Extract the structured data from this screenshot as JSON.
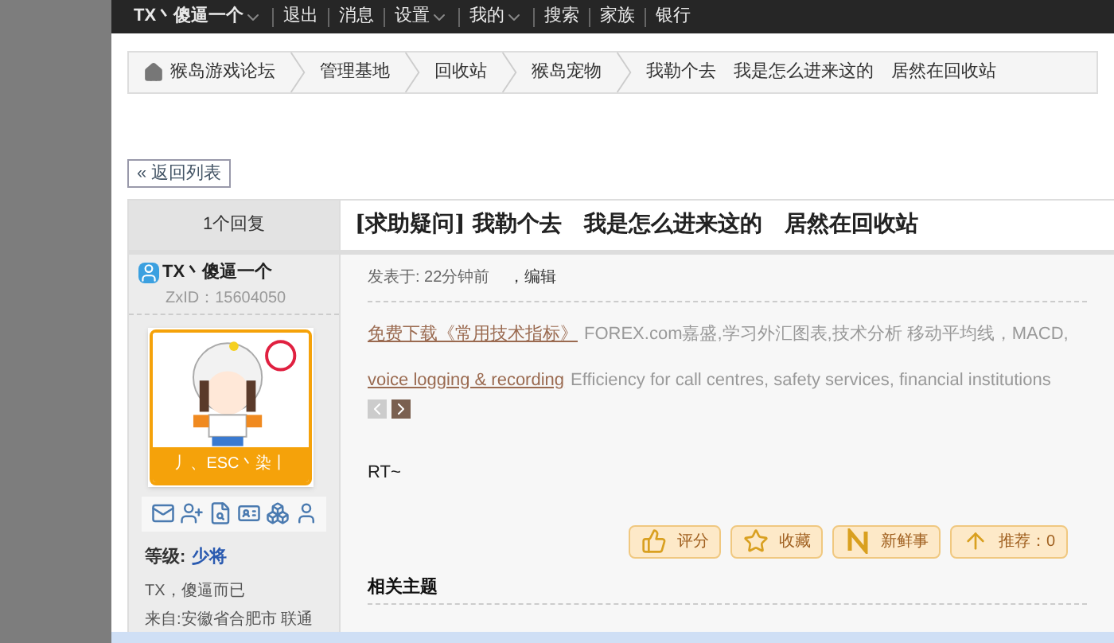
{
  "top_nav": [
    {
      "label": "TX丶傻逼一个",
      "dropdown": true
    },
    {
      "label": "退出",
      "dropdown": false
    },
    {
      "label": "消息",
      "dropdown": false
    },
    {
      "label": "设置",
      "dropdown": true
    },
    {
      "label": "我的",
      "dropdown": true
    },
    {
      "label": "搜索",
      "dropdown": false
    },
    {
      "label": "家族",
      "dropdown": false
    },
    {
      "label": "银行",
      "dropdown": false
    }
  ],
  "breadcrumb": [
    "猴岛游戏论坛",
    "管理基地",
    "回收站",
    "猴岛宠物",
    "我勒个去　我是怎么进来这的　居然在回收站"
  ],
  "back_button": "« 返回列表",
  "reply_count": "1个回复",
  "thread_title": "[求助疑问] 我勒个去　我是怎么进来这的　居然在回收站",
  "author": {
    "name": "TX丶傻逼一个",
    "id": "ZxID：15604050",
    "avatar_caption": "丿、ESC丶染丨",
    "level_label": "等级:",
    "level": "少将",
    "signature": "TX，傻逼而已",
    "location": "来自:安徽省合肥市 联通"
  },
  "post": {
    "meta": "发表于: 22分钟前",
    "edit": "，编辑",
    "ads": [
      {
        "link": "免费下载《常用技术指标》",
        "text": "FOREX.com嘉盛,学习外汇图表,技术分析 移动平均线，MACD,"
      },
      {
        "link": "voice logging & recording",
        "text": "Efficiency for call centres, safety services, financial institutions"
      }
    ],
    "body": "RT~",
    "actions": [
      {
        "kind": "thumb",
        "label": "评分"
      },
      {
        "kind": "star",
        "label": "收藏"
      },
      {
        "kind": "news",
        "label": "新鲜事"
      },
      {
        "kind": "up",
        "label": "推荐：0"
      }
    ],
    "related": "相关主题"
  }
}
